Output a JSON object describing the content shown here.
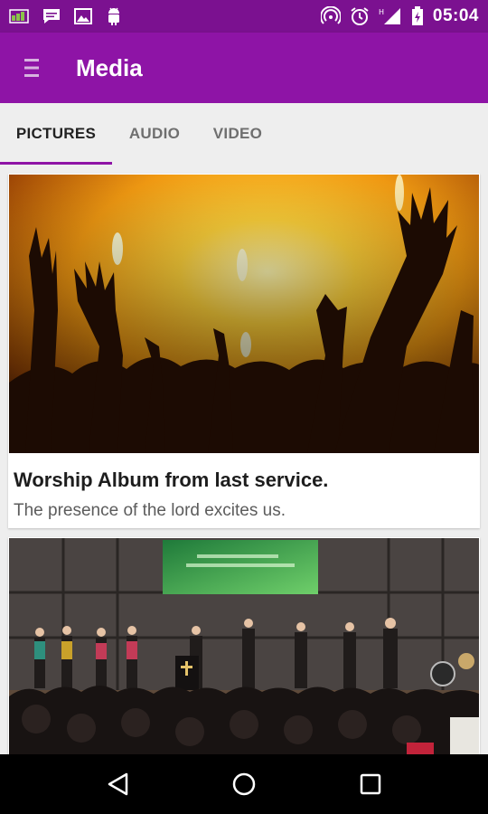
{
  "status_bar": {
    "time": "05:04",
    "left_icons": [
      "sim-card-icon",
      "chat-bubble-icon",
      "image-icon",
      "android-icon"
    ],
    "right_icons": [
      "hotspot-icon",
      "alarm-icon",
      "signal-icon",
      "battery-icon"
    ],
    "background": "#7b1190"
  },
  "app_bar": {
    "title": "Media",
    "menu_icon": "hamburger-menu-icon",
    "background": "#8e14a6"
  },
  "tabs": [
    {
      "label": "PICTURES",
      "active": true
    },
    {
      "label": "AUDIO",
      "active": false
    },
    {
      "label": "VIDEO",
      "active": false
    }
  ],
  "cards": [
    {
      "title": "Worship Album from last service.",
      "subtitle": "The presence of the lord excites us.",
      "image": "concert-hands-photo"
    },
    {
      "title": "",
      "subtitle": "",
      "image": "worship-stage-photo"
    }
  ],
  "nav_bar": {
    "icons": [
      "back-icon",
      "home-icon",
      "recents-icon"
    ]
  },
  "colors": {
    "accent": "#8e14a6",
    "status_bar": "#7b1190",
    "background": "#eeeeee"
  }
}
